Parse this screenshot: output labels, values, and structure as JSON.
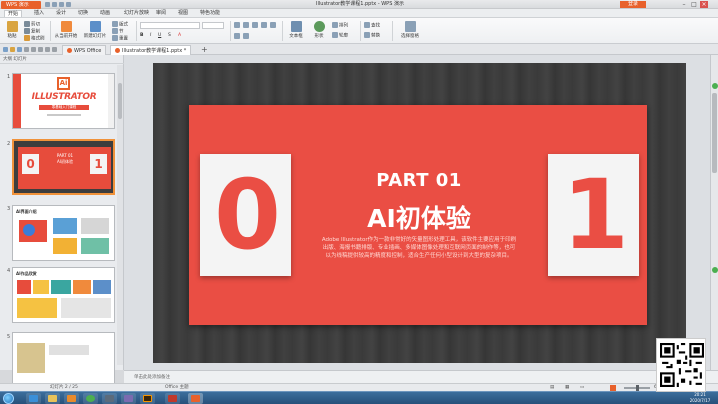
{
  "titlebar": {
    "app_button": "WPS 演示",
    "document_title": "Illustrator教学课程1.pptx - WPS 演示",
    "login_button": "登录"
  },
  "menu": {
    "items": [
      "开始",
      "插入",
      "设计",
      "切换",
      "动画",
      "幻灯片放映",
      "审阅",
      "视图",
      "特色功能"
    ]
  },
  "ribbon": {
    "paste": "粘贴",
    "cut": "剪切",
    "copy": "复制",
    "format_painter": "格式刷",
    "from_current": "从当前开始",
    "new_slide": "新建幻灯片",
    "layout": "版式",
    "section": "节",
    "reset": "重置",
    "font_combo": "",
    "size_combo": "",
    "textbox": "文本框",
    "shapes": "形状",
    "arrange": "排列",
    "outline": "轮廓",
    "find": "查找",
    "replace": "替换",
    "select": "选择窗格"
  },
  "tabs": {
    "home": "WPS Office",
    "doc": "Illustrator教学课程1.pptx *"
  },
  "panel": {
    "header": "大纲 幻灯片",
    "thumbnails": [
      {
        "num": "1",
        "logo": "Ai",
        "title": "ILLUSTRATOR",
        "subtitle": "零基础入门课程"
      },
      {
        "num": "2",
        "left": "0",
        "right": "1",
        "title": "PART 01",
        "subtitle": "AI初体验"
      },
      {
        "num": "3",
        "heading": "AI界面介绍"
      },
      {
        "num": "4",
        "heading": "AI作品欣赏"
      },
      {
        "num": "5",
        "heading": ""
      }
    ]
  },
  "slide": {
    "left_number": "0",
    "right_number": "1",
    "part": "PART 01",
    "headline": "AI初体验",
    "description": "Adobe Illustrator作为一款非常好的矢量图形处理工具，该软件主要应用于印刷出版、海报书籍排版、专业插画、多媒体图像处理和互联网页面的制作等，也可以为线稿提供较高的精度和控制，适合生产任何小型设计到大型的复杂项目。"
  },
  "notes": {
    "placeholder": "单击此处添加备注"
  },
  "status": {
    "slide_pos": "幻灯片 2 / 25",
    "theme": "Office 主题",
    "zoom": "67 %"
  },
  "taskbar": {
    "time": "20:21",
    "date": "2020/7/17"
  },
  "colors": {
    "accent": "#ea4e44",
    "wps_orange": "#e8612b",
    "slide_bg": "#3d3d3d"
  }
}
